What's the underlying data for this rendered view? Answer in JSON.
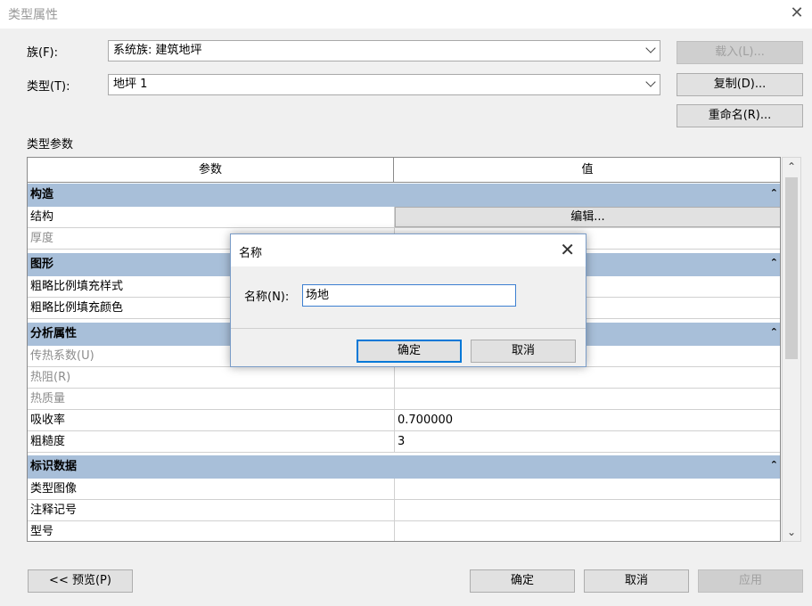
{
  "window": {
    "title": "类型属性"
  },
  "family": {
    "label": "族(F):",
    "value": "系统族: 建筑地坪"
  },
  "type": {
    "label": "类型(T):",
    "value": "地坪 1"
  },
  "buttons": {
    "load": "载入(L)...",
    "duplicate": "复制(D)...",
    "rename": "重命名(R)..."
  },
  "type_params_label": "类型参数",
  "table": {
    "col_param": "参数",
    "col_value": "值",
    "groups": [
      {
        "name": "构造",
        "rows": [
          {
            "param": "结构",
            "value": "编辑..."
          },
          {
            "param": "厚度",
            "value": ""
          }
        ]
      },
      {
        "name": "图形",
        "rows": [
          {
            "param": "粗略比例填充样式",
            "value": ""
          },
          {
            "param": "粗略比例填充颜色",
            "value": ""
          }
        ]
      },
      {
        "name": "分析属性",
        "rows": [
          {
            "param": "传热系数(U)",
            "value": ""
          },
          {
            "param": "热阻(R)",
            "value": ""
          },
          {
            "param": "热质量",
            "value": ""
          },
          {
            "param": "吸收率",
            "value": "0.700000"
          },
          {
            "param": "粗糙度",
            "value": "3"
          }
        ]
      },
      {
        "name": "标识数据",
        "rows": [
          {
            "param": "类型图像",
            "value": ""
          },
          {
            "param": "注释记号",
            "value": ""
          },
          {
            "param": "型号",
            "value": ""
          }
        ]
      }
    ]
  },
  "footer": {
    "preview": "<< 预览(P)",
    "ok": "确定",
    "cancel": "取消",
    "apply": "应用"
  },
  "dialog": {
    "title": "名称",
    "field_label": "名称(N):",
    "field_value": "场地",
    "ok": "确定",
    "cancel": "取消"
  }
}
